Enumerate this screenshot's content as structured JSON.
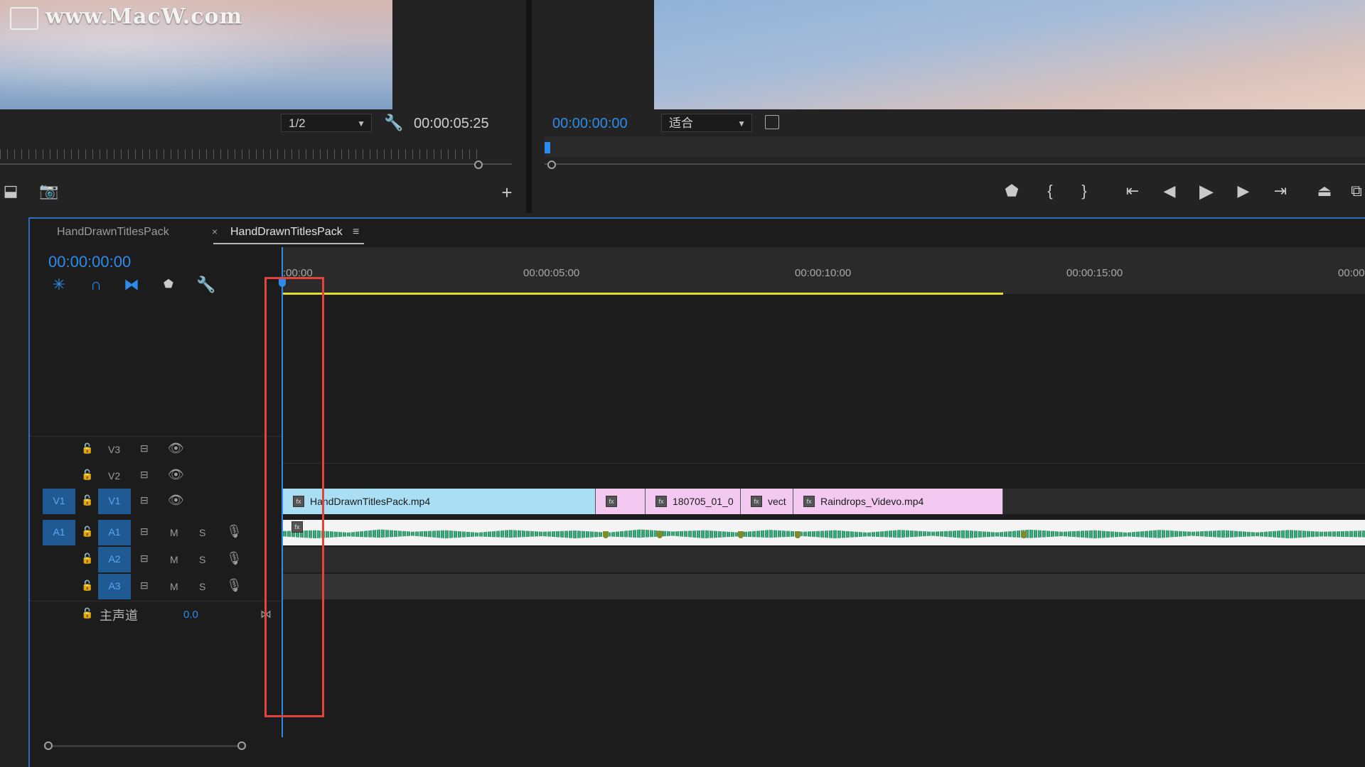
{
  "watermark": {
    "text": "www.MacW.com"
  },
  "source_monitor": {
    "zoom_dropdown": "1/2",
    "duration": "00:00:05:25"
  },
  "program_monitor": {
    "timecode": "00:00:00:00",
    "fit_dropdown": "适合",
    "transport_icons": [
      "marker-icon",
      "mark-in-icon",
      "mark-out-icon",
      "go-to-in-icon",
      "step-back-icon",
      "play-icon",
      "step-forward-icon",
      "go-to-out-icon",
      "lift-icon",
      "extract-icon"
    ]
  },
  "timeline": {
    "tabs": [
      {
        "label": "HandDrawnTitlesPack",
        "active": false
      },
      {
        "label": "HandDrawnTitlesPack",
        "active": true
      }
    ],
    "timecode": "00:00:00:00",
    "ruler_labels": [
      ":00:00",
      "00:00:05:00",
      "00:00:10:00",
      "00:00:15:00",
      "00:00"
    ],
    "tracks": {
      "video": [
        {
          "name": "V3",
          "source": ""
        },
        {
          "name": "V2",
          "source": ""
        },
        {
          "name": "V1",
          "source": "V1"
        }
      ],
      "audio": [
        {
          "name": "A1",
          "source": "A1",
          "m": "M",
          "s": "S"
        },
        {
          "name": "A2",
          "source": "",
          "m": "M",
          "s": "S"
        },
        {
          "name": "A3",
          "source": "",
          "m": "M",
          "s": "S"
        }
      ],
      "master": {
        "label": "主声道",
        "value": "0.0"
      }
    },
    "clips": [
      {
        "label": "HandDrawnTitlesPack.mp4",
        "color": "#a9def5"
      },
      {
        "label": "",
        "color": "#f3c9f2"
      },
      {
        "label": "180705_01_0",
        "color": "#f3c9f2"
      },
      {
        "label": "vect",
        "color": "#f3c9f2"
      },
      {
        "label": "Raindrops_Videvo.mp4",
        "color": "#f3c9f2"
      }
    ],
    "colors": {
      "accent": "#2d8ceb",
      "work_area": "#e5dc2e",
      "audio_wave": "#2e9a6e",
      "highlight_box": "#e0443a"
    }
  }
}
